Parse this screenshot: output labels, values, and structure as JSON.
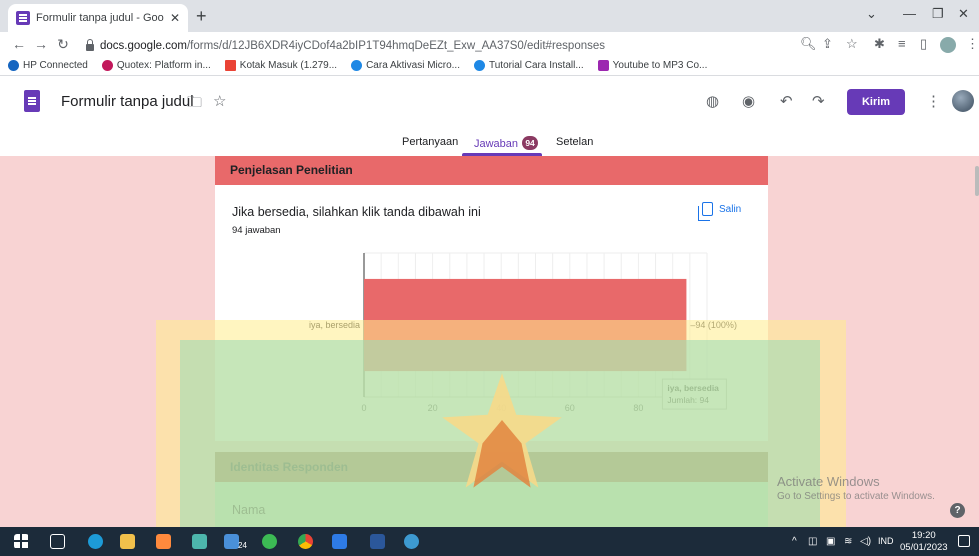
{
  "browser": {
    "tab_title": "Formulir tanpa judul - Google Fo",
    "url_main": "docs.google.com",
    "url_rest": "/forms/d/12JB6XDR4iyCDof4a2bIP1T94hmqDeEZt_Exw_AA37S0/edit#responses",
    "bookmarks": [
      {
        "label": "HP Connected",
        "color": "#1565c0"
      },
      {
        "label": "Quotex: Platform in...",
        "color": "#c2185b"
      },
      {
        "label": "Kotak Masuk (1.279...",
        "color": "#ea4335"
      },
      {
        "label": "Cara Aktivasi Micro...",
        "color": "#1e88e5"
      },
      {
        "label": "Tutorial Cara Install...",
        "color": "#1e88e5"
      },
      {
        "label": "Youtube to MP3 Co...",
        "color": "#9c27b0"
      }
    ]
  },
  "form": {
    "title": "Formulir tanpa judul",
    "send_label": "Kirim",
    "tabs": {
      "questions": "Pertanyaan",
      "responses": "Jawaban",
      "responses_count": "94",
      "settings": "Setelan"
    }
  },
  "section1": {
    "header": "Penjelasan Penelitian",
    "question": "Jika bersedia, silahkan klik tanda dibawah ini",
    "response_count": "94 jawaban",
    "copy_label": "Salin"
  },
  "chart_data": {
    "type": "bar",
    "orientation": "horizontal",
    "categories": [
      "iya, bersedia"
    ],
    "values": [
      94
    ],
    "value_labels": [
      "94 (100%)"
    ],
    "xlim": [
      0,
      100
    ],
    "xticks": [
      0,
      20,
      40,
      60,
      80
    ],
    "grid": true,
    "bar_color": "#e8696a",
    "tooltip": {
      "title": "iya, bersedia",
      "line": "Jumlah: 94"
    }
  },
  "section2": {
    "header": "Identitas Responden",
    "field": "Nama"
  },
  "watermark": {
    "line1": "Activate Windows",
    "line2": "Go to Settings to activate Windows."
  },
  "taskbar": {
    "badge": "24",
    "lang": "IND",
    "time": "19:20",
    "date": "05/01/2023"
  },
  "colors": {
    "accent": "#673ab7",
    "section1_header": "#e8696a",
    "section2_header": "#9c5f45"
  }
}
